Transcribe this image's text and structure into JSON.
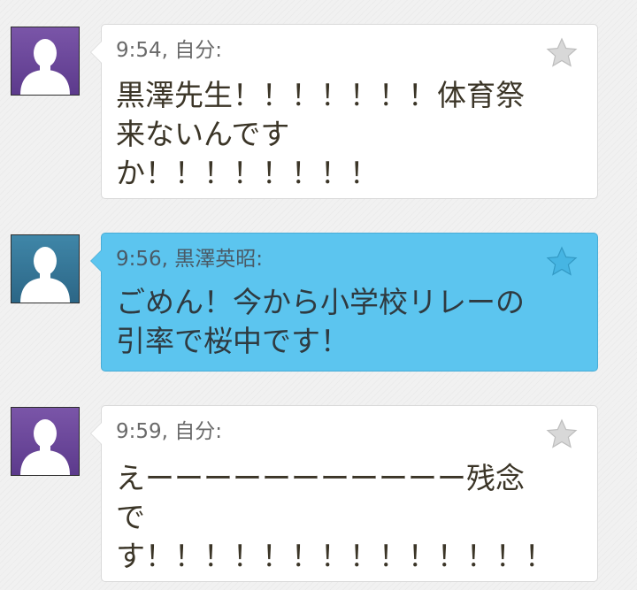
{
  "messages": [
    {
      "time": "9:54",
      "sender": "自分",
      "meta": "9:54, 自分:",
      "text": "黒澤先生！！！！！！！体育祭来ないんですか！！！！！！！！",
      "style": "outgoing",
      "bubble_color": "#ffffff",
      "avatar_color": "#6a4a9c",
      "avatar_icon": "user-silhouette-icon",
      "star_icon": "star-icon"
    },
    {
      "time": "9:56",
      "sender": "黒澤英昭",
      "meta": "9:56, 黒澤英昭:",
      "text": "ごめん！今から小学校リレーの引率で桜中です！",
      "style": "incoming",
      "bubble_color": "#5cc5ef",
      "avatar_color": "#357899",
      "avatar_icon": "user-silhouette-icon",
      "star_icon": "star-icon"
    },
    {
      "time": "9:59",
      "sender": "自分",
      "meta": "9:59, 自分:",
      "text": "えーーーーーーーーーーー残念です！！！！！！！！！！！！！！",
      "style": "outgoing",
      "bubble_color": "#ffffff",
      "avatar_color": "#6a4a9c",
      "avatar_icon": "user-silhouette-icon",
      "star_icon": "star-icon"
    }
  ]
}
